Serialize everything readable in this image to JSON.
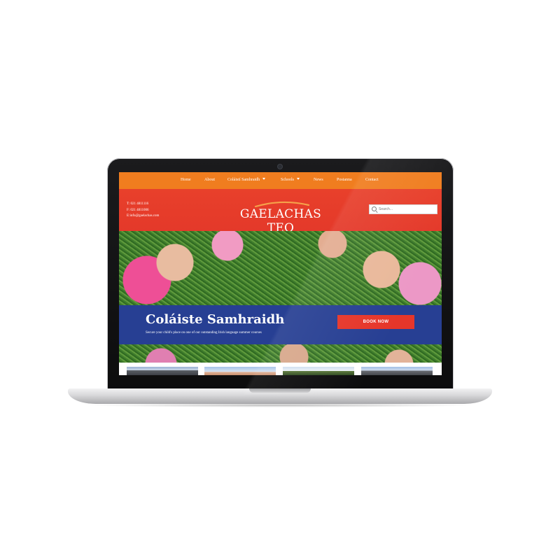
{
  "nav": {
    "items": [
      {
        "label": "Home",
        "has_dropdown": false
      },
      {
        "label": "About",
        "has_dropdown": false
      },
      {
        "label": "Coláistí Samhraidh",
        "has_dropdown": true
      },
      {
        "label": "Schools",
        "has_dropdown": true
      },
      {
        "label": "News",
        "has_dropdown": false
      },
      {
        "label": "Postanna",
        "has_dropdown": false
      },
      {
        "label": "Contact",
        "has_dropdown": false
      }
    ]
  },
  "header": {
    "phone": "T: 021 4811116",
    "fax": "F: 021 4811006",
    "email": "E:info@gaelachas.com",
    "logo_text": "GAELACHAS TEO",
    "search_placeholder": "Search..."
  },
  "banner": {
    "title": "Coláiste Samhraidh",
    "subtitle": "Secure your child's place on one of our outstanding Irish language summer courses",
    "button_label": "BOOK NOW"
  },
  "colors": {
    "nav_bg": "#f07d1f",
    "header_bg": "#e4392a",
    "banner_bg": "#273f93",
    "button_bg": "#e6362a"
  },
  "icons": [
    "search-icon",
    "caret-down-icon",
    "camera-icon",
    "logo-arc-icon"
  ]
}
